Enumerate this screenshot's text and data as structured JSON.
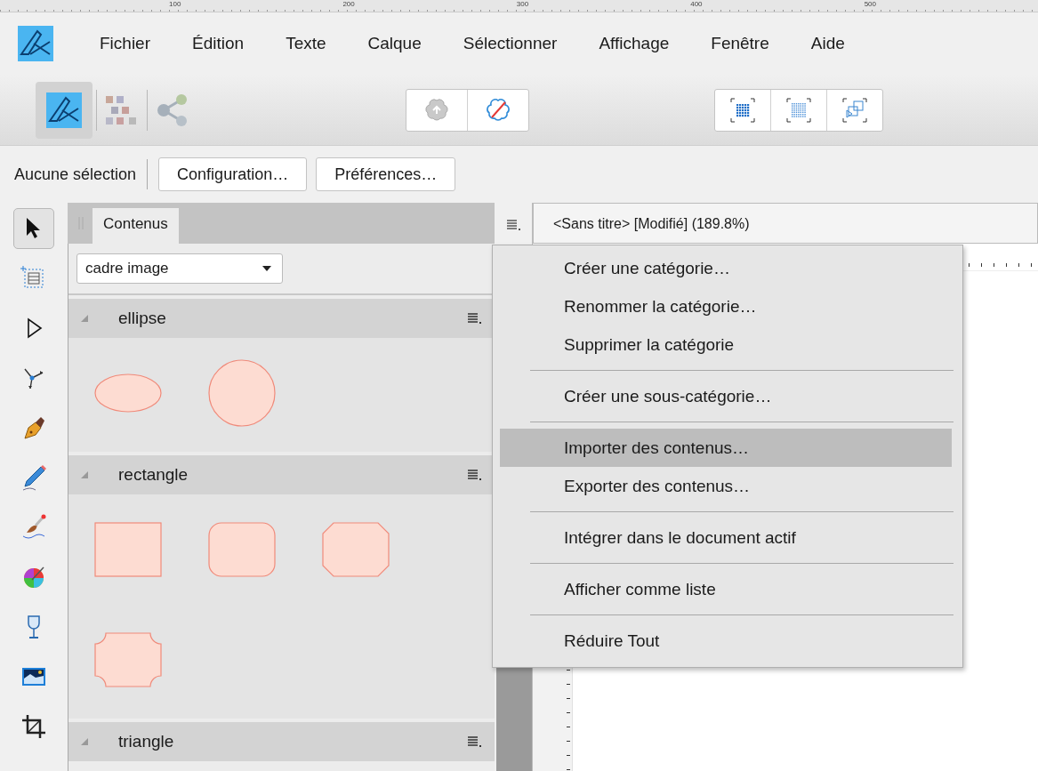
{
  "ruler": {
    "labels": [
      "100",
      "200",
      "300",
      "400",
      "500"
    ]
  },
  "menu_bar": {
    "items": [
      "Fichier",
      "Édition",
      "Texte",
      "Calque",
      "Sélectionner",
      "Affichage",
      "Fenêtre",
      "Aide"
    ]
  },
  "toolbar": {
    "personas": [
      {
        "kind": "designer",
        "selected": true
      },
      {
        "kind": "pixel",
        "selected": false
      },
      {
        "kind": "export",
        "selected": false
      }
    ],
    "groups": [
      [
        {
          "kind": "flower-up"
        },
        {
          "kind": "flower-off"
        }
      ],
      [
        {
          "kind": "grid-dense"
        },
        {
          "kind": "grid-fine"
        },
        {
          "kind": "cubes"
        }
      ]
    ]
  },
  "context_bar": {
    "status": "Aucune sélection",
    "buttons": [
      "Configuration…",
      "Préférences…"
    ]
  },
  "tools": [
    {
      "kind": "pointer",
      "selected": true
    },
    {
      "kind": "frame-text",
      "selected": false
    },
    {
      "kind": "node",
      "selected": false
    },
    {
      "kind": "corner",
      "selected": false
    },
    {
      "kind": "pen",
      "selected": false
    },
    {
      "kind": "pencil",
      "selected": false
    },
    {
      "kind": "brush",
      "selected": false
    },
    {
      "kind": "color-wheel",
      "selected": false
    },
    {
      "kind": "glass",
      "selected": false
    },
    {
      "kind": "picture",
      "selected": false
    },
    {
      "kind": "crop",
      "selected": false
    }
  ],
  "panel": {
    "tab": "Contenus",
    "dropdown": "cadre image",
    "categories": [
      {
        "name": "ellipse",
        "expanded": true,
        "items": [
          {
            "kind": "ellipse"
          },
          {
            "kind": "circle"
          }
        ]
      },
      {
        "name": "rectangle",
        "expanded": true,
        "items": [
          {
            "kind": "square"
          },
          {
            "kind": "rounded"
          },
          {
            "kind": "bevel"
          },
          {
            "kind": "notched"
          }
        ]
      },
      {
        "name": "triangle",
        "expanded": true
      }
    ]
  },
  "document": {
    "title": "<Sans titre> [Modifié] (189.8%)"
  },
  "context_menu": {
    "items": [
      {
        "kind": "item",
        "label": "Créer une catégorie…",
        "highlighted": false
      },
      {
        "kind": "item",
        "label": "Renommer la catégorie…",
        "highlighted": false
      },
      {
        "kind": "item",
        "label": "Supprimer la catégorie",
        "highlighted": false
      },
      {
        "kind": "separator"
      },
      {
        "kind": "item",
        "label": "Créer une sous-catégorie…",
        "highlighted": false
      },
      {
        "kind": "separator"
      },
      {
        "kind": "item",
        "label": "Importer des contenus…",
        "highlighted": true
      },
      {
        "kind": "item",
        "label": "Exporter des contenus…",
        "highlighted": false
      },
      {
        "kind": "separator"
      },
      {
        "kind": "item",
        "label": "Intégrer dans le document actif",
        "highlighted": false
      },
      {
        "kind": "separator"
      },
      {
        "kind": "item",
        "label": "Afficher comme liste",
        "highlighted": false
      },
      {
        "kind": "separator"
      },
      {
        "kind": "item",
        "label": "Réduire Tout",
        "highlighted": false
      }
    ]
  }
}
